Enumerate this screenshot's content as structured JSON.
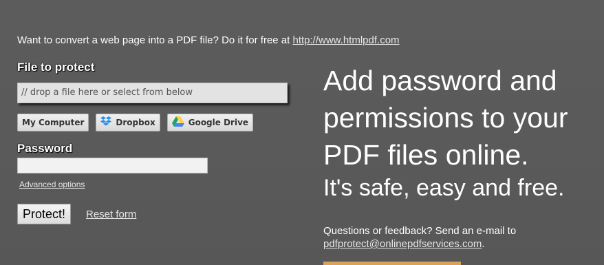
{
  "promo": {
    "text": "Want to convert a web page into a PDF file? Do it for free at ",
    "link": "http://www.htmlpdf.com"
  },
  "form": {
    "file_label": "File to protect",
    "drop_placeholder": "// drop a file here or select from below",
    "sources": [
      {
        "label": "My Computer",
        "icon": "computer-icon"
      },
      {
        "label": "Dropbox",
        "icon": "dropbox-icon"
      },
      {
        "label": "Google Drive",
        "icon": "google-drive-icon"
      }
    ],
    "password_label": "Password",
    "password_value": "",
    "advanced_link": "Advanced options",
    "protect_button": "Protect!",
    "reset_link": "Reset form"
  },
  "hero": {
    "line1": "Add password and",
    "line2": "permissions to your",
    "line3": "PDF files online.",
    "subtitle": "It's safe, easy and free."
  },
  "contact": {
    "text": "Questions or feedback? Send an e-mail to",
    "email": "pdfprotect@onlinepdfservices.com",
    "suffix": "."
  },
  "colors": {
    "background": "#5a5a5a",
    "dropbox_blue": "#2a8fe6",
    "drive_green": "#1fa463",
    "drive_yellow": "#ffcf48",
    "drive_blue": "#4285f4"
  }
}
